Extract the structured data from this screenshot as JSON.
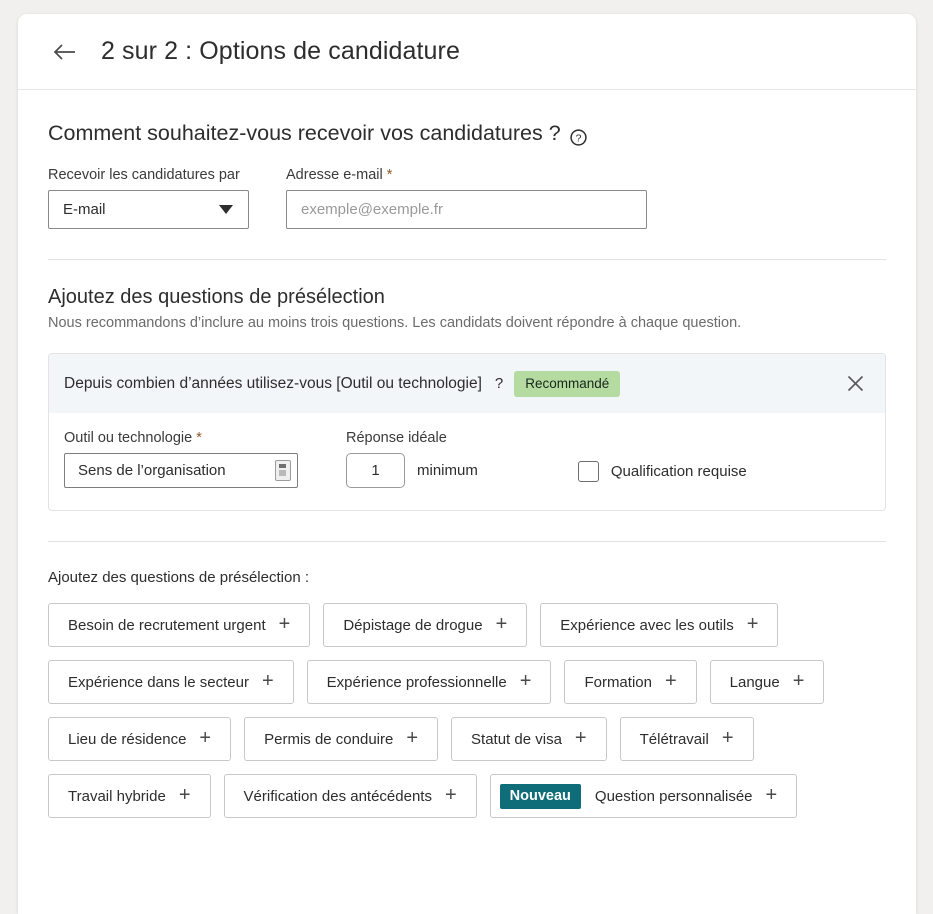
{
  "header": {
    "back_icon": "arrow-left-icon",
    "title": "2 sur 2 : Options de candidature"
  },
  "delivery_section": {
    "heading": "Comment souhaitez-vous recevoir vos candidatures ?",
    "help_icon": "question-circle-icon",
    "method": {
      "label": "Recevoir les candidatures par",
      "value": "E-mail",
      "options": [
        "E-mail"
      ],
      "caret_icon": "chevron-down-icon"
    },
    "email": {
      "label": "Adresse e-mail",
      "required_marker": "*",
      "value": "",
      "placeholder": "exemple@exemple.fr"
    }
  },
  "screening_section": {
    "heading": "Ajoutez des questions de présélection",
    "subtitle": "Nous recommandons d’inclure au moins trois questions. Les candidats doivent répondre à chaque question.",
    "question_card": {
      "title": "Depuis combien d’années utilisez-vous [Outil ou technologie]",
      "question_mark": "?",
      "badge": "Recommandé",
      "badge_color": "#b5dba1",
      "close_icon": "close-icon",
      "tool_field": {
        "label": "Outil ou technologie",
        "required_marker": "*",
        "value": "Sens de l’organisation",
        "trailing_icon": "autofill-icon"
      },
      "ideal_answer": {
        "label": "Réponse idéale",
        "value": "1",
        "suffix": "minimum"
      },
      "required_qualification": {
        "label": "Qualification requise",
        "checked": false
      }
    }
  },
  "chips_section": {
    "intro": "Ajoutez des questions de présélection :",
    "new_badge": "Nouveau",
    "new_badge_color": "#0e6d79",
    "plus_icon": "plus-icon",
    "items": [
      {
        "label": "Besoin de recrutement urgent",
        "new": false
      },
      {
        "label": "Dépistage de drogue",
        "new": false
      },
      {
        "label": "Expérience avec les outils",
        "new": false
      },
      {
        "label": "Expérience dans le secteur",
        "new": false
      },
      {
        "label": "Expérience professionnelle",
        "new": false
      },
      {
        "label": "Formation",
        "new": false
      },
      {
        "label": "Langue",
        "new": false
      },
      {
        "label": "Lieu de résidence",
        "new": false
      },
      {
        "label": "Permis de conduire",
        "new": false
      },
      {
        "label": "Statut de visa",
        "new": false
      },
      {
        "label": "Télétravail",
        "new": false
      },
      {
        "label": "Travail hybride",
        "new": false
      },
      {
        "label": "Vérification des antécédents",
        "new": false
      },
      {
        "label": "Question personnalisée",
        "new": true
      }
    ]
  }
}
